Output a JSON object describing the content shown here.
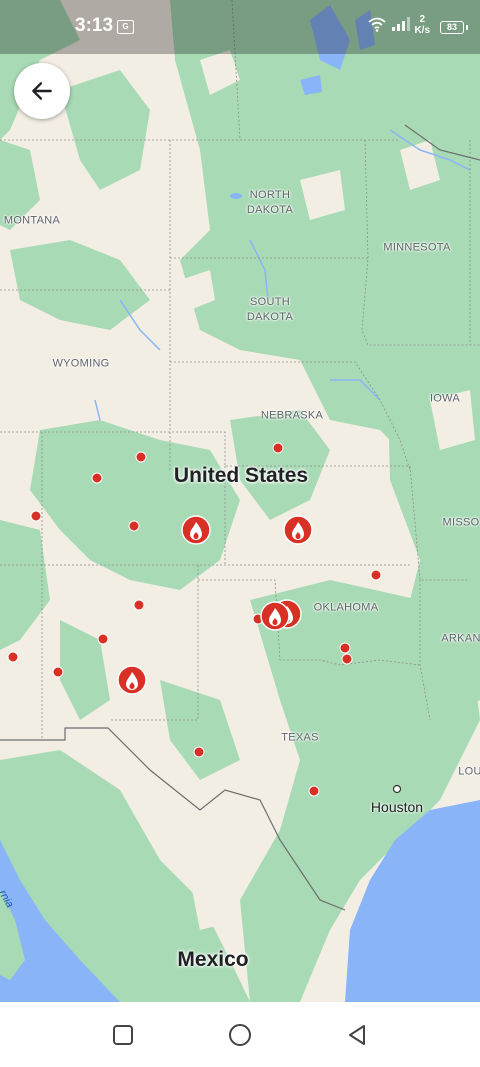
{
  "status_bar": {
    "time": "3:13",
    "carrier_badge": "G",
    "net_speed_value": "2",
    "net_speed_unit": "K/s",
    "battery": "83"
  },
  "map": {
    "colors": {
      "land": "#f3eee4",
      "vegetation": "#a8dab5",
      "water": "#8ab4f8",
      "fire_marker": "#d93025"
    },
    "labels": {
      "north_dakota": "NORTH\nDAKOTA",
      "south_dakota": "SOUTH\nDAKOTA",
      "montana": "MONTANA",
      "minnesota": "MINNESOTA",
      "wyoming": "WYOMING",
      "iowa": "IOWA",
      "nebraska": "NEBRASKA",
      "missouri": "MISSO",
      "oklahoma": "OKLAHOMA",
      "arkansas": "ARKAN",
      "texas": "TEXAS",
      "louisiana": "LOU",
      "united_states": "United States",
      "mexico": "Mexico",
      "houston": "Houston",
      "gulf_of_california": "rnia"
    },
    "fire_icon_name": "flame-icon",
    "small_fire_icon_name": "fire-dot-icon"
  },
  "navigation": {
    "back_icon": "arrow-left-icon",
    "recent_apps_icon": "square-icon",
    "home_icon": "circle-icon",
    "back_nav_icon": "triangle-left-icon"
  }
}
